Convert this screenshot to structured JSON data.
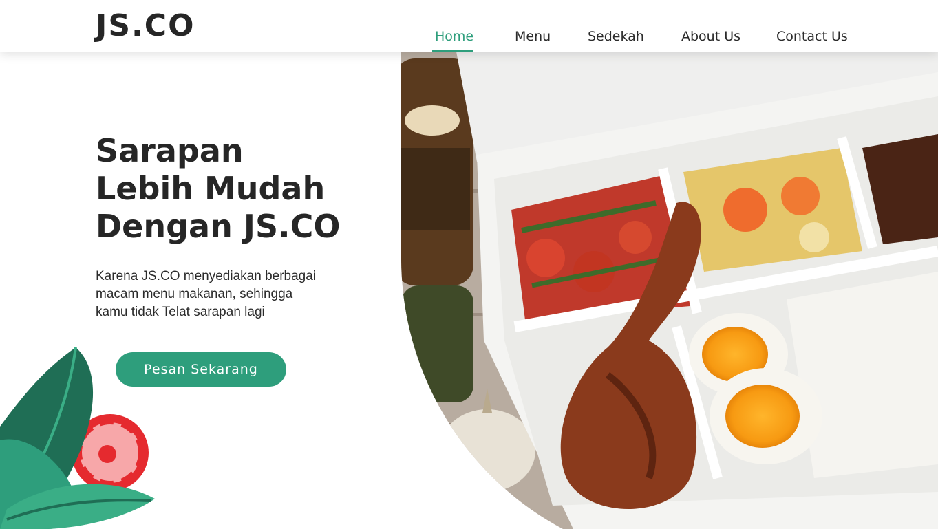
{
  "brand": {
    "logo": "JS.CO"
  },
  "nav": {
    "items": [
      {
        "label": "Home",
        "active": true
      },
      {
        "label": "Menu",
        "active": false
      },
      {
        "label": "Sedekah",
        "active": false
      },
      {
        "label": "About Us",
        "active": false
      },
      {
        "label": "Contact Us",
        "active": false
      }
    ]
  },
  "hero": {
    "title_lines": [
      "Sarapan",
      "Lebih Mudah",
      "Dengan JS.CO"
    ],
    "description_lines": [
      "Karena JS.CO menyediakan berbagai",
      "macam menu makanan, sehingga",
      "kamu tidak Telat sarapan lagi"
    ],
    "cta_label": "Pesan Sekarang"
  },
  "colors": {
    "accent": "#2e9e7c",
    "text": "#262626",
    "leaf_dark": "#1f6e55",
    "leaf_light": "#3aae86",
    "tomato": "#e52a2f"
  },
  "icons": {
    "hero_image": "food-bento-box-image",
    "decoration": "leaf-tomato-decoration"
  }
}
